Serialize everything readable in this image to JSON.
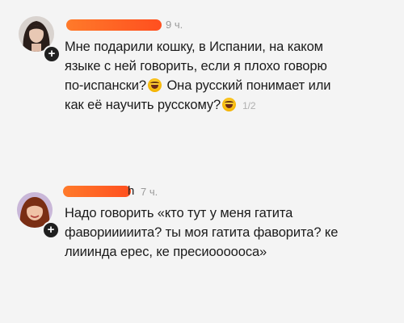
{
  "comments": [
    {
      "author_suffix": "",
      "time": "9 ч.",
      "line1": "Мне подарили кошку, в Испании, на каком",
      "line2": "языке с ней говорить, если я плохо говорю",
      "line3a": "по-испански?",
      "line3b": " Она русский понимает или",
      "line4": "как её научить русскому?",
      "counter": "1/2"
    },
    {
      "author_suffix": "h",
      "time": "7 ч.",
      "line1": "Надо говорить «кто тут у меня гатита",
      "line2": "фаворииииита? ты моя гатита фаворита? ке",
      "line3": "лииинда ерес, ке пресиоооооса»"
    }
  ],
  "icons": {
    "follow": "plus-icon",
    "emoji": "rofl-emoji-icon"
  },
  "colors": {
    "redaction": "#ff5a24",
    "time": "#9a9a9a"
  }
}
